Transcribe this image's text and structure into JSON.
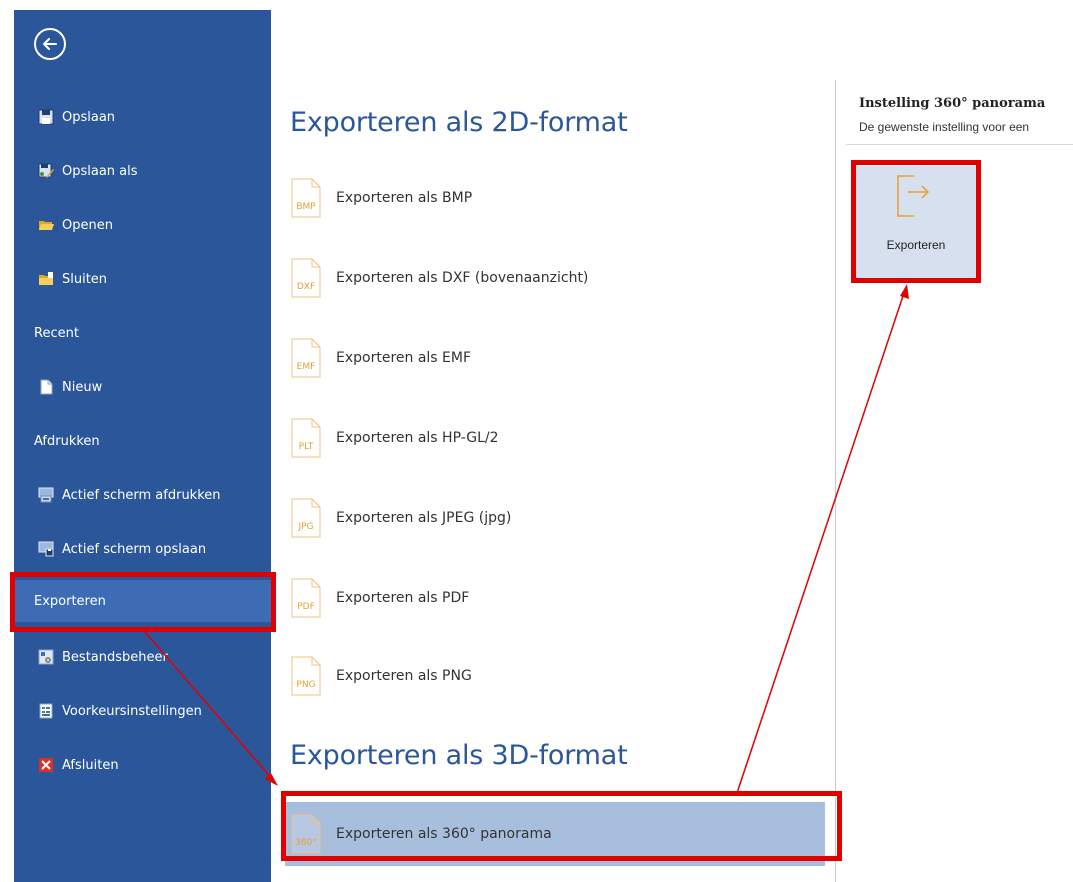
{
  "sidebar": {
    "items": [
      {
        "label": "Opslaan",
        "icon": "save-icon"
      },
      {
        "label": "Opslaan als",
        "icon": "save-as-icon"
      },
      {
        "label": "Openen",
        "icon": "open-folder-icon"
      },
      {
        "label": "Sluiten",
        "icon": "close-folder-icon"
      },
      {
        "label": "Recent"
      },
      {
        "label": "Nieuw",
        "icon": "new-document-icon"
      },
      {
        "label": "Afdrukken"
      },
      {
        "label": "Actief scherm afdrukken",
        "icon": "print-screen-icon"
      },
      {
        "label": "Actief scherm opslaan",
        "icon": "save-screen-icon"
      },
      {
        "label": "Exporteren",
        "selected": true
      },
      {
        "label": "Bestandsbeheer",
        "icon": "file-manager-icon"
      },
      {
        "label": "Voorkeursinstellingen",
        "icon": "preferences-icon"
      },
      {
        "label": "Afsluiten",
        "icon": "exit-icon"
      }
    ]
  },
  "export": {
    "section2d_title": "Exporteren als 2D-format",
    "items2d": [
      {
        "badge": "BMP",
        "label": "Exporteren als BMP"
      },
      {
        "badge": "DXF",
        "label": "Exporteren als DXF (bovenaanzicht)"
      },
      {
        "badge": "EMF",
        "label": "Exporteren als EMF"
      },
      {
        "badge": "PLT",
        "label": "Exporteren als HP-GL/2"
      },
      {
        "badge": "JPG",
        "label": "Exporteren als JPEG (jpg)"
      },
      {
        "badge": "PDF",
        "label": "Exporteren als PDF"
      },
      {
        "badge": "PNG",
        "label": "Exporteren als PNG"
      }
    ],
    "section3d_title": "Exporteren als 3D-format",
    "items3d": [
      {
        "badge": "360°",
        "label": "Exporteren als 360° panorama",
        "selected": true
      }
    ]
  },
  "panel": {
    "title": "Instelling 360° panorama",
    "description": "De gewenste instelling voor een",
    "export_button": "Exporteren"
  },
  "colors": {
    "sidebar": "#2b579a",
    "sidebar_selected": "#3d6cb5",
    "accent": "#e8a030",
    "highlight": "#e00000"
  }
}
